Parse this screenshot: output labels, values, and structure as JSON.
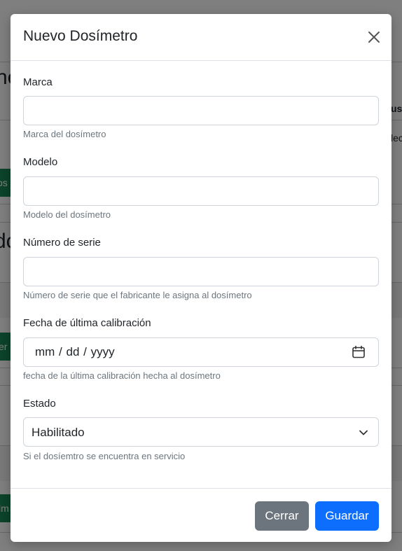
{
  "modal": {
    "title": "Nuevo Dosímetro",
    "close_icon": "close-icon"
  },
  "form": {
    "marca": {
      "label": "Marca",
      "value": "",
      "help": "Marca del dosímetro"
    },
    "modelo": {
      "label": "Modelo",
      "value": "",
      "help": "Modelo del dosímetro"
    },
    "serie": {
      "label": "Número de serie",
      "value": "",
      "help": "Número de serie que el fabricante le asigna al dosímetro"
    },
    "calibracion": {
      "label": "Fecha de última calibración",
      "placeholder": "mm / dd / yyyy",
      "icon": "calendar-icon",
      "help": "fecha de la última calibración hecha al dosímetro"
    },
    "estado": {
      "label": "Estado",
      "selected": "Habilitado",
      "icon": "chevron-down-icon",
      "help": "Si el dosíemtro se encuentra en servicio"
    }
  },
  "footer": {
    "close_label": "Cerrar",
    "save_label": "Guardar"
  },
  "background": {
    "fragment_1": "ne",
    "fragment_2": "us",
    "fragment_3": "lec",
    "fragment_4": "os",
    "fragment_5": "do",
    "fragment_6": "er",
    "fragment_7": "lm"
  },
  "colors": {
    "primary": "#0d6efd",
    "secondary": "#6c757d",
    "success": "#198754",
    "help_text": "#6c757d",
    "border": "#ced4da"
  }
}
